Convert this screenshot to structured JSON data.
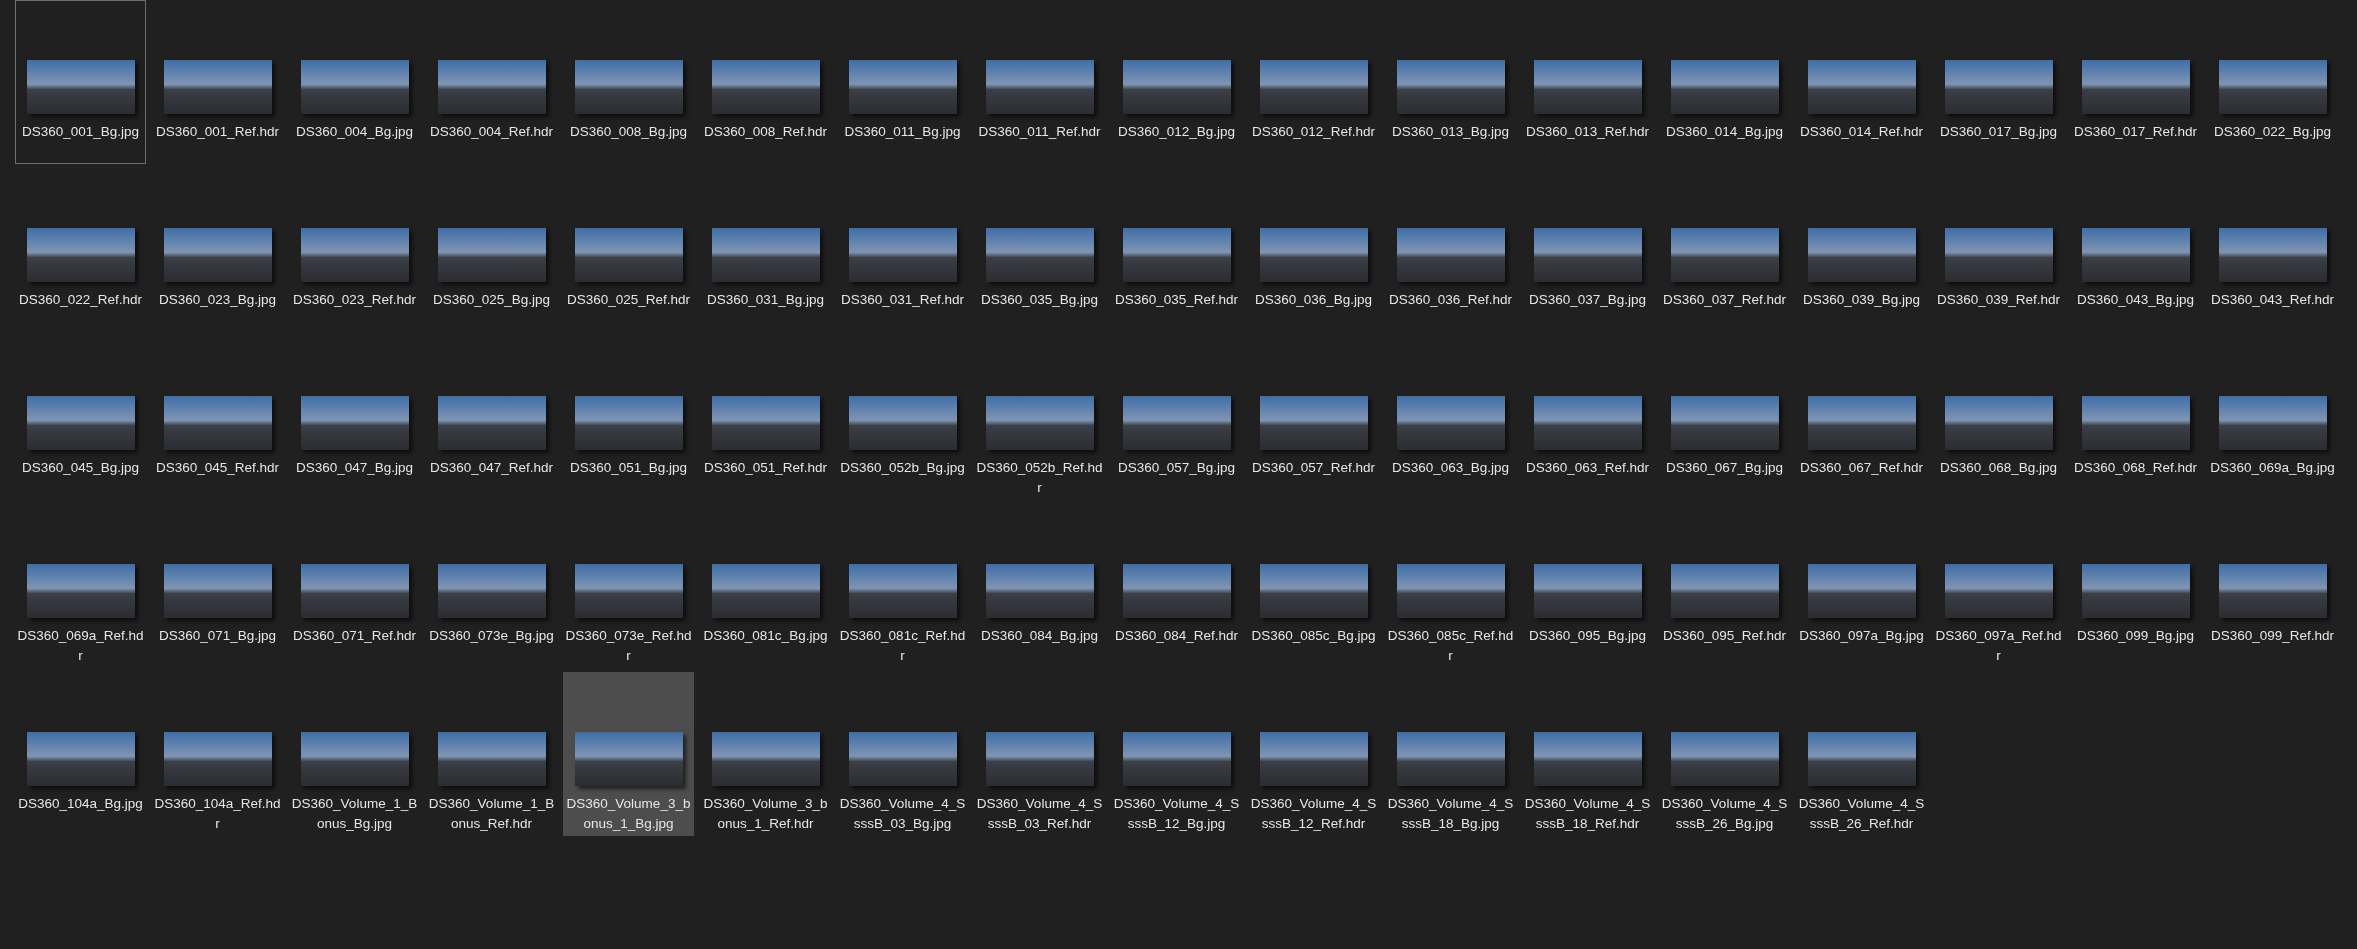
{
  "files": [
    {
      "name": "DS360_001_Bg.jpg",
      "selected": false,
      "focused": true
    },
    {
      "name": "DS360_001_Ref.hdr",
      "selected": false,
      "focused": false
    },
    {
      "name": "DS360_004_Bg.jpg",
      "selected": false,
      "focused": false
    },
    {
      "name": "DS360_004_Ref.hdr",
      "selected": false,
      "focused": false
    },
    {
      "name": "DS360_008_Bg.jpg",
      "selected": false,
      "focused": false
    },
    {
      "name": "DS360_008_Ref.hdr",
      "selected": false,
      "focused": false
    },
    {
      "name": "DS360_011_Bg.jpg",
      "selected": false,
      "focused": false
    },
    {
      "name": "DS360_011_Ref.hdr",
      "selected": false,
      "focused": false
    },
    {
      "name": "DS360_012_Bg.jpg",
      "selected": false,
      "focused": false
    },
    {
      "name": "DS360_012_Ref.hdr",
      "selected": false,
      "focused": false
    },
    {
      "name": "DS360_013_Bg.jpg",
      "selected": false,
      "focused": false
    },
    {
      "name": "DS360_013_Ref.hdr",
      "selected": false,
      "focused": false
    },
    {
      "name": "DS360_014_Bg.jpg",
      "selected": false,
      "focused": false
    },
    {
      "name": "DS360_014_Ref.hdr",
      "selected": false,
      "focused": false
    },
    {
      "name": "DS360_017_Bg.jpg",
      "selected": false,
      "focused": false
    },
    {
      "name": "DS360_017_Ref.hdr",
      "selected": false,
      "focused": false
    },
    {
      "name": "DS360_022_Bg.jpg",
      "selected": false,
      "focused": false
    },
    {
      "name": "DS360_022_Ref.hdr",
      "selected": false,
      "focused": false
    },
    {
      "name": "DS360_023_Bg.jpg",
      "selected": false,
      "focused": false
    },
    {
      "name": "DS360_023_Ref.hdr",
      "selected": false,
      "focused": false
    },
    {
      "name": "DS360_025_Bg.jpg",
      "selected": false,
      "focused": false
    },
    {
      "name": "DS360_025_Ref.hdr",
      "selected": false,
      "focused": false
    },
    {
      "name": "DS360_031_Bg.jpg",
      "selected": false,
      "focused": false
    },
    {
      "name": "DS360_031_Ref.hdr",
      "selected": false,
      "focused": false
    },
    {
      "name": "DS360_035_Bg.jpg",
      "selected": false,
      "focused": false
    },
    {
      "name": "DS360_035_Ref.hdr",
      "selected": false,
      "focused": false
    },
    {
      "name": "DS360_036_Bg.jpg",
      "selected": false,
      "focused": false
    },
    {
      "name": "DS360_036_Ref.hdr",
      "selected": false,
      "focused": false
    },
    {
      "name": "DS360_037_Bg.jpg",
      "selected": false,
      "focused": false
    },
    {
      "name": "DS360_037_Ref.hdr",
      "selected": false,
      "focused": false
    },
    {
      "name": "DS360_039_Bg.jpg",
      "selected": false,
      "focused": false
    },
    {
      "name": "DS360_039_Ref.hdr",
      "selected": false,
      "focused": false
    },
    {
      "name": "DS360_043_Bg.jpg",
      "selected": false,
      "focused": false
    },
    {
      "name": "DS360_043_Ref.hdr",
      "selected": false,
      "focused": false
    },
    {
      "name": "DS360_045_Bg.jpg",
      "selected": false,
      "focused": false
    },
    {
      "name": "DS360_045_Ref.hdr",
      "selected": false,
      "focused": false
    },
    {
      "name": "DS360_047_Bg.jpg",
      "selected": false,
      "focused": false
    },
    {
      "name": "DS360_047_Ref.hdr",
      "selected": false,
      "focused": false
    },
    {
      "name": "DS360_051_Bg.jpg",
      "selected": false,
      "focused": false
    },
    {
      "name": "DS360_051_Ref.hdr",
      "selected": false,
      "focused": false
    },
    {
      "name": "DS360_052b_Bg.jpg",
      "selected": false,
      "focused": false
    },
    {
      "name": "DS360_052b_Ref.hdr",
      "selected": false,
      "focused": false
    },
    {
      "name": "DS360_057_Bg.jpg",
      "selected": false,
      "focused": false
    },
    {
      "name": "DS360_057_Ref.hdr",
      "selected": false,
      "focused": false
    },
    {
      "name": "DS360_063_Bg.jpg",
      "selected": false,
      "focused": false
    },
    {
      "name": "DS360_063_Ref.hdr",
      "selected": false,
      "focused": false
    },
    {
      "name": "DS360_067_Bg.jpg",
      "selected": false,
      "focused": false
    },
    {
      "name": "DS360_067_Ref.hdr",
      "selected": false,
      "focused": false
    },
    {
      "name": "DS360_068_Bg.jpg",
      "selected": false,
      "focused": false
    },
    {
      "name": "DS360_068_Ref.hdr",
      "selected": false,
      "focused": false
    },
    {
      "name": "DS360_069a_Bg.jpg",
      "selected": false,
      "focused": false
    },
    {
      "name": "DS360_069a_Ref.hdr",
      "selected": false,
      "focused": false
    },
    {
      "name": "DS360_071_Bg.jpg",
      "selected": false,
      "focused": false
    },
    {
      "name": "DS360_071_Ref.hdr",
      "selected": false,
      "focused": false
    },
    {
      "name": "DS360_073e_Bg.jpg",
      "selected": false,
      "focused": false
    },
    {
      "name": "DS360_073e_Ref.hdr",
      "selected": false,
      "focused": false
    },
    {
      "name": "DS360_081c_Bg.jpg",
      "selected": false,
      "focused": false
    },
    {
      "name": "DS360_081c_Ref.hdr",
      "selected": false,
      "focused": false
    },
    {
      "name": "DS360_084_Bg.jpg",
      "selected": false,
      "focused": false
    },
    {
      "name": "DS360_084_Ref.hdr",
      "selected": false,
      "focused": false
    },
    {
      "name": "DS360_085c_Bg.jpg",
      "selected": false,
      "focused": false
    },
    {
      "name": "DS360_085c_Ref.hdr",
      "selected": false,
      "focused": false
    },
    {
      "name": "DS360_095_Bg.jpg",
      "selected": false,
      "focused": false
    },
    {
      "name": "DS360_095_Ref.hdr",
      "selected": false,
      "focused": false
    },
    {
      "name": "DS360_097a_Bg.jpg",
      "selected": false,
      "focused": false
    },
    {
      "name": "DS360_097a_Ref.hdr",
      "selected": false,
      "focused": false
    },
    {
      "name": "DS360_099_Bg.jpg",
      "selected": false,
      "focused": false
    },
    {
      "name": "DS360_099_Ref.hdr",
      "selected": false,
      "focused": false
    },
    {
      "name": "DS360_104a_Bg.jpg",
      "selected": false,
      "focused": false
    },
    {
      "name": "DS360_104a_Ref.hdr",
      "selected": false,
      "focused": false
    },
    {
      "name": "DS360_Volume_1_Bonus_Bg.jpg",
      "selected": false,
      "focused": false
    },
    {
      "name": "DS360_Volume_1_Bonus_Ref.hdr",
      "selected": false,
      "focused": false
    },
    {
      "name": "DS360_Volume_3_bonus_1_Bg.jpg",
      "selected": true,
      "focused": false
    },
    {
      "name": "DS360_Volume_3_bonus_1_Ref.hdr",
      "selected": false,
      "focused": false
    },
    {
      "name": "DS360_Volume_4_SsssB_03_Bg.jpg",
      "selected": false,
      "focused": false
    },
    {
      "name": "DS360_Volume_4_SsssB_03_Ref.hdr",
      "selected": false,
      "focused": false
    },
    {
      "name": "DS360_Volume_4_SsssB_12_Bg.jpg",
      "selected": false,
      "focused": false
    },
    {
      "name": "DS360_Volume_4_SsssB_12_Ref.hdr",
      "selected": false,
      "focused": false
    },
    {
      "name": "DS360_Volume_4_SsssB_18_Bg.jpg",
      "selected": false,
      "focused": false
    },
    {
      "name": "DS360_Volume_4_SsssB_18_Ref.hdr",
      "selected": false,
      "focused": false
    },
    {
      "name": "DS360_Volume_4_SsssB_26_Bg.jpg",
      "selected": false,
      "focused": false
    },
    {
      "name": "DS360_Volume_4_SsssB_26_Ref.hdr",
      "selected": false,
      "focused": false
    }
  ]
}
